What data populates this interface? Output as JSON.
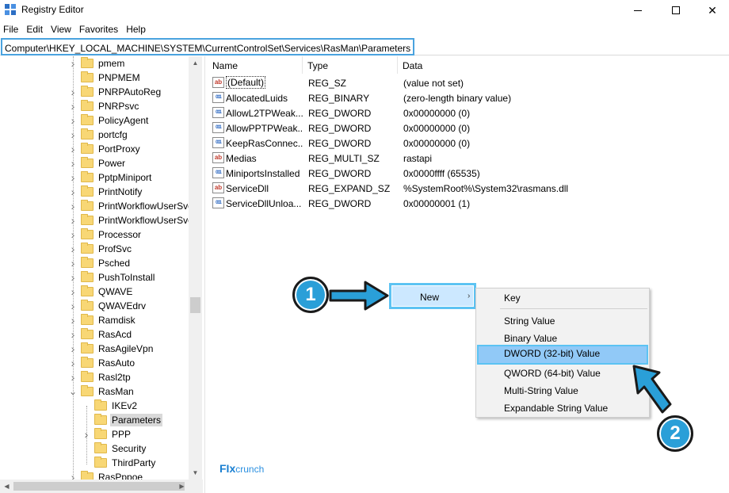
{
  "window": {
    "title": "Registry Editor"
  },
  "menu": [
    "File",
    "Edit",
    "View",
    "Favorites",
    "Help"
  ],
  "address": "Computer\\HKEY_LOCAL_MACHINE\\SYSTEM\\CurrentControlSet\\Services\\RasMan\\Parameters",
  "tree": {
    "items": [
      {
        "label": "pmem",
        "level": 1,
        "expander": ">"
      },
      {
        "label": "PNPMEM",
        "level": 1,
        "expander": ""
      },
      {
        "label": "PNRPAutoReg",
        "level": 1,
        "expander": ">"
      },
      {
        "label": "PNRPsvc",
        "level": 1,
        "expander": ">"
      },
      {
        "label": "PolicyAgent",
        "level": 1,
        "expander": ">"
      },
      {
        "label": "portcfg",
        "level": 1,
        "expander": ">"
      },
      {
        "label": "PortProxy",
        "level": 1,
        "expander": ">"
      },
      {
        "label": "Power",
        "level": 1,
        "expander": ">"
      },
      {
        "label": "PptpMiniport",
        "level": 1,
        "expander": ">"
      },
      {
        "label": "PrintNotify",
        "level": 1,
        "expander": ">"
      },
      {
        "label": "PrintWorkflowUserSvc",
        "level": 1,
        "expander": ">"
      },
      {
        "label": "PrintWorkflowUserSvc_",
        "level": 1,
        "expander": ">"
      },
      {
        "label": "Processor",
        "level": 1,
        "expander": ">"
      },
      {
        "label": "ProfSvc",
        "level": 1,
        "expander": ">"
      },
      {
        "label": "Psched",
        "level": 1,
        "expander": ">"
      },
      {
        "label": "PushToInstall",
        "level": 1,
        "expander": ">"
      },
      {
        "label": "QWAVE",
        "level": 1,
        "expander": ">"
      },
      {
        "label": "QWAVEdrv",
        "level": 1,
        "expander": ">"
      },
      {
        "label": "Ramdisk",
        "level": 1,
        "expander": ">"
      },
      {
        "label": "RasAcd",
        "level": 1,
        "expander": ">"
      },
      {
        "label": "RasAgileVpn",
        "level": 1,
        "expander": ">"
      },
      {
        "label": "RasAuto",
        "level": 1,
        "expander": ">"
      },
      {
        "label": "Rasl2tp",
        "level": 1,
        "expander": ">"
      },
      {
        "label": "RasMan",
        "level": 1,
        "expander": "v"
      },
      {
        "label": "IKEv2",
        "level": 2,
        "expander": ""
      },
      {
        "label": "Parameters",
        "level": 2,
        "expander": "",
        "selected": true
      },
      {
        "label": "PPP",
        "level": 2,
        "expander": ">"
      },
      {
        "label": "Security",
        "level": 2,
        "expander": ""
      },
      {
        "label": "ThirdParty",
        "level": 2,
        "expander": ""
      },
      {
        "label": "RasPppoe",
        "level": 1,
        "expander": ">"
      }
    ]
  },
  "list": {
    "columns": [
      "Name",
      "Type",
      "Data"
    ],
    "rows": [
      {
        "name": "(Default)",
        "type": "REG_SZ",
        "data": "(value not set)",
        "icon": "string"
      },
      {
        "name": "AllocatedLuids",
        "type": "REG_BINARY",
        "data": "(zero-length binary value)",
        "icon": "binary"
      },
      {
        "name": "AllowL2TPWeak...",
        "type": "REG_DWORD",
        "data": "0x00000000 (0)",
        "icon": "binary"
      },
      {
        "name": "AllowPPTPWeak...",
        "type": "REG_DWORD",
        "data": "0x00000000 (0)",
        "icon": "binary"
      },
      {
        "name": "KeepRasConnec...",
        "type": "REG_DWORD",
        "data": "0x00000000 (0)",
        "icon": "binary"
      },
      {
        "name": "Medias",
        "type": "REG_MULTI_SZ",
        "data": "rastapi",
        "icon": "string"
      },
      {
        "name": "MiniportsInstalled",
        "type": "REG_DWORD",
        "data": "0x0000ffff (65535)",
        "icon": "binary"
      },
      {
        "name": "ServiceDll",
        "type": "REG_EXPAND_SZ",
        "data": "%SystemRoot%\\System32\\rasmans.dll",
        "icon": "string"
      },
      {
        "name": "ServiceDllUnloa...",
        "type": "REG_DWORD",
        "data": "0x00000001 (1)",
        "icon": "binary"
      }
    ]
  },
  "context_menu": {
    "new_label": "New",
    "new_arrow": "›",
    "submenu": [
      "Key",
      "String Value",
      "Binary Value",
      "DWORD (32-bit) Value",
      "QWORD (64-bit) Value",
      "Multi-String Value",
      "Expandable String Value"
    ],
    "highlighted": "DWORD (32-bit) Value"
  },
  "annotations": {
    "step1": "1",
    "step2": "2"
  },
  "watermark": {
    "bold": "FIx",
    "light": "crunch"
  },
  "colors": {
    "accent": "#2a9fd8",
    "highlight": "#91c9f7",
    "folder": "#f8d775"
  }
}
